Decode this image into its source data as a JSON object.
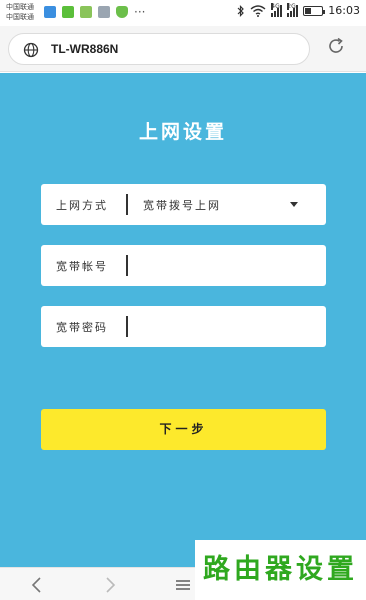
{
  "status_bar": {
    "carrier_line1": "中国联通",
    "carrier_line2": "中国联通",
    "more": "···",
    "network_1": "4G",
    "network_2": "2G",
    "battery_level": 0.35,
    "time": "16:03"
  },
  "browser": {
    "url": "TL-WR886N",
    "icons": [
      "globe-icon",
      "refresh-icon"
    ]
  },
  "page": {
    "title": "上网设置",
    "fields": [
      {
        "label": "上网方式",
        "value": "宽带拨号上网",
        "type": "select"
      },
      {
        "label": "宽带帐号",
        "value": "",
        "type": "text"
      },
      {
        "label": "宽带密码",
        "value": "",
        "type": "password"
      }
    ],
    "next_button": "下一步"
  },
  "nav": {
    "icons": [
      "back-icon",
      "forward-icon",
      "menu-icon"
    ]
  },
  "watermark": "路由器设置",
  "colors": {
    "page_background": "#4ab6dd",
    "button": "#fde92c",
    "watermark": "#2fa81f"
  }
}
